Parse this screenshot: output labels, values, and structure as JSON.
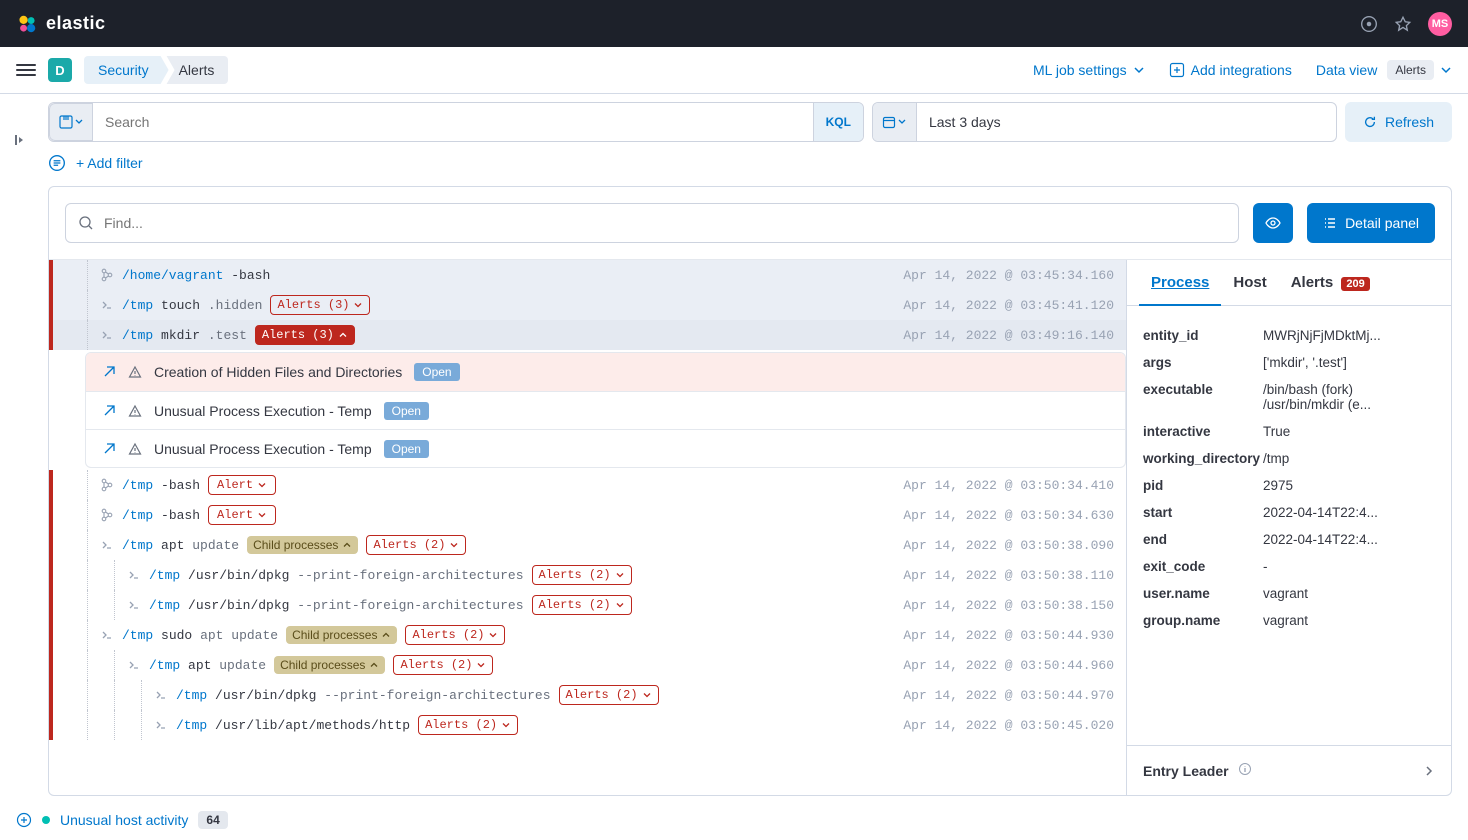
{
  "header": {
    "brand": "elastic",
    "avatar": "MS"
  },
  "subheader": {
    "space": "D",
    "breadcrumb1": "Security",
    "breadcrumb2": "Alerts",
    "ml_jobs": "ML job settings",
    "add_integrations": "Add integrations",
    "data_view": "Data view",
    "data_view_badge": "Alerts"
  },
  "query": {
    "search_placeholder": "Search",
    "kql": "KQL",
    "date_text": "Last 3 days",
    "refresh": "Refresh"
  },
  "filter": {
    "add_filter": "+ Add filter"
  },
  "toolbar": {
    "find_placeholder": "Find...",
    "detail_panel": "Detail panel"
  },
  "tree": [
    {
      "type": "branch",
      "indent": 1,
      "icon": "branch",
      "path": "/home/vagrant",
      "cmd": "-bash",
      "ts": "Apr 14, 2022 @ 03:45:34.160",
      "sel": true
    },
    {
      "type": "leaf",
      "indent": 1,
      "icon": "prompt",
      "path": "/tmp",
      "cmd": "touch",
      "arg": ".hidden",
      "alerts": "Alerts (3)",
      "alerts_style": "outline-down",
      "ts": "Apr 14, 2022 @ 03:45:41.120",
      "sel": true
    },
    {
      "type": "leaf",
      "indent": 1,
      "icon": "prompt",
      "path": "/tmp",
      "cmd": "mkdir",
      "arg": ".test",
      "alerts": "Alerts (3)",
      "alerts_style": "filled-up",
      "ts": "Apr 14, 2022 @ 03:49:16.140",
      "sel": true,
      "dark": true
    },
    {
      "type": "alertblock",
      "items": [
        {
          "title": "Creation of Hidden Files and Directories",
          "status": "Open",
          "highlight": true
        },
        {
          "title": "Unusual Process Execution - Temp",
          "status": "Open"
        },
        {
          "title": "Unusual Process Execution - Temp",
          "status": "Open"
        }
      ]
    },
    {
      "type": "branch",
      "indent": 1,
      "icon": "branch",
      "path": "/tmp",
      "cmd": "-bash",
      "alert_single": "Alert",
      "ts": "Apr 14, 2022 @ 03:50:34.410"
    },
    {
      "type": "branch",
      "indent": 1,
      "icon": "branch",
      "path": "/tmp",
      "cmd": "-bash",
      "alert_single": "Alert",
      "ts": "Apr 14, 2022 @ 03:50:34.630"
    },
    {
      "type": "leaf",
      "indent": 1,
      "icon": "prompt",
      "path": "/tmp",
      "cmd": "apt",
      "arg": "update",
      "child": "Child processes",
      "alerts": "Alerts (2)",
      "alerts_style": "outline-down",
      "ts": "Apr 14, 2022 @ 03:50:38.090"
    },
    {
      "type": "leaf",
      "indent": 2,
      "icon": "prompt",
      "path": "/tmp",
      "cmd": "/usr/bin/dpkg",
      "arg": "--print-foreign-architectures",
      "alerts": "Alerts (2)",
      "alerts_style": "outline-down",
      "ts": "Apr 14, 2022 @ 03:50:38.110"
    },
    {
      "type": "leaf",
      "indent": 2,
      "icon": "prompt",
      "path": "/tmp",
      "cmd": "/usr/bin/dpkg",
      "arg": "--print-foreign-architectures",
      "alerts": "Alerts (2)",
      "alerts_style": "outline-down",
      "ts": "Apr 14, 2022 @ 03:50:38.150"
    },
    {
      "type": "leaf",
      "indent": 1,
      "icon": "prompt",
      "path": "/tmp",
      "cmd": "sudo",
      "arg": "apt update",
      "child": "Child processes",
      "alerts": "Alerts (2)",
      "alerts_style": "outline-down",
      "ts": "Apr 14, 2022 @ 03:50:44.930"
    },
    {
      "type": "leaf",
      "indent": 2,
      "icon": "prompt",
      "path": "/tmp",
      "cmd": "apt",
      "arg": "update",
      "child": "Child processes",
      "alerts": "Alerts (2)",
      "alerts_style": "outline-down",
      "ts": "Apr 14, 2022 @ 03:50:44.960"
    },
    {
      "type": "leaf",
      "indent": 3,
      "icon": "prompt",
      "path": "/tmp",
      "cmd": "/usr/bin/dpkg",
      "arg": "--print-foreign-architectures",
      "alerts": "Alerts (2)",
      "alerts_style": "outline-down",
      "ts": "Apr 14, 2022 @ 03:50:44.970"
    },
    {
      "type": "leaf",
      "indent": 3,
      "icon": "prompt",
      "path": "/tmp",
      "cmd": "/usr/lib/apt/methods/http",
      "alerts": "Alerts (2)",
      "alerts_style": "outline-down",
      "ts": "Apr 14, 2022 @ 03:50:45.020"
    }
  ],
  "detail": {
    "tabs": {
      "process": "Process",
      "host": "Host",
      "alerts": "Alerts",
      "alerts_count": "209"
    },
    "fields": [
      {
        "k": "entity_id",
        "v": "MWRjNjFjMDktMj..."
      },
      {
        "k": "args",
        "v": "['mkdir', '.test']"
      },
      {
        "k": "executable",
        "v": "/bin/bash (fork)\n/usr/bin/mkdir (e..."
      },
      {
        "k": "interactive",
        "v": "True"
      },
      {
        "k": "working_directory",
        "v": "/tmp"
      },
      {
        "k": "pid",
        "v": "2975"
      },
      {
        "k": "start",
        "v": "2022-04-14T22:4..."
      },
      {
        "k": "end",
        "v": "2022-04-14T22:4..."
      },
      {
        "k": "exit_code",
        "v": "-"
      },
      {
        "k": "user.name",
        "v": "vagrant"
      },
      {
        "k": "group.name",
        "v": "vagrant"
      }
    ],
    "entry_leader": "Entry Leader"
  },
  "footer": {
    "timeline": "Unusual host activity",
    "count": "64"
  }
}
